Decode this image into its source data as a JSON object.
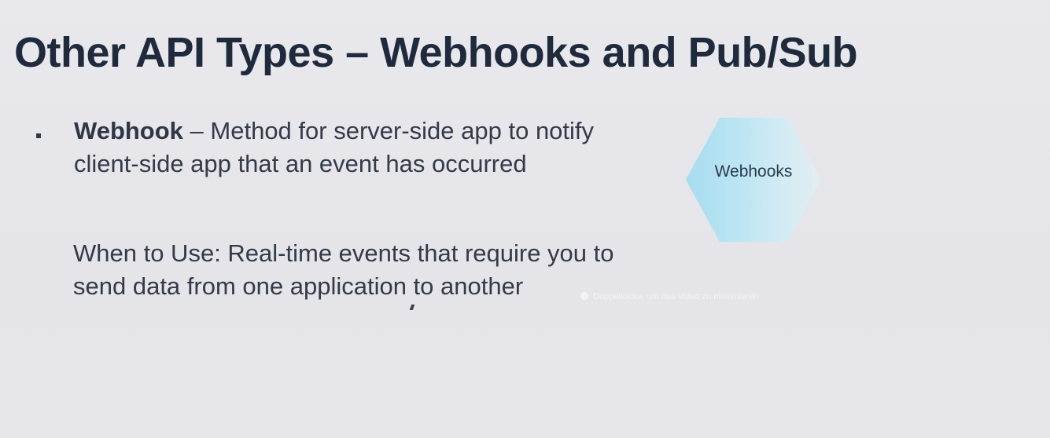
{
  "slide": {
    "title": "Other API Types – Webhooks and Pub/Sub",
    "bullet": {
      "term": "Webhook",
      "description": " – Method for server-side app to notify client-side app that an event has occurred"
    },
    "when_to_use": "When to Use:  Real-time events that require you to send data from one application to another",
    "hexagon_label": "Webhooks"
  },
  "video_overlay": {
    "hint_text": "Doppelklicke, um das Video zu maximieren"
  }
}
